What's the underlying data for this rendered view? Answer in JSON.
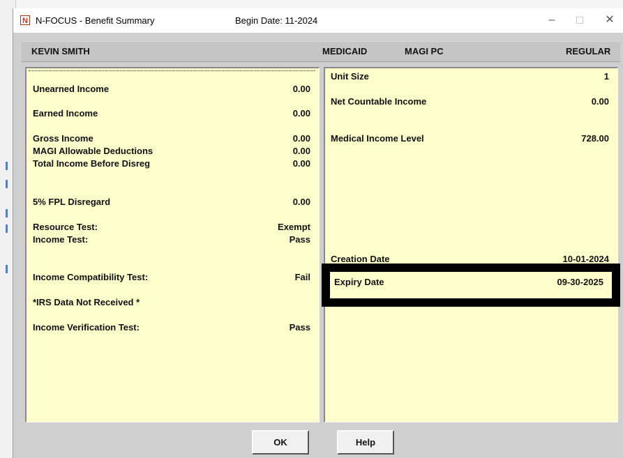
{
  "window": {
    "title": "N-FOCUS - Benefit Summary",
    "begin_date": "Begin Date: 11-2024",
    "icon_letter": "N",
    "minimize": "–",
    "maximize": "☐",
    "close": "✕"
  },
  "header": {
    "name": "KEVIN SMITH",
    "program": "MEDICAID",
    "subprogram": "MAGI PC",
    "type": "REGULAR"
  },
  "left_panel": {
    "unearned_income": {
      "label": "Unearned Income",
      "value": "0.00"
    },
    "earned_income": {
      "label": "Earned Income",
      "value": "0.00"
    },
    "gross_income": {
      "label": "Gross Income",
      "value": "0.00"
    },
    "magi_deductions": {
      "label": "MAGI Allowable Deductions",
      "value": "0.00"
    },
    "total_income": {
      "label": "Total Income Before Disreg",
      "value": "0.00"
    },
    "fpl_disregard": {
      "label": "5% FPL Disregard",
      "value": "0.00"
    },
    "resource_test": {
      "label": "Resource Test:",
      "value": "Exempt"
    },
    "income_test": {
      "label": "Income Test:",
      "value": "Pass"
    },
    "income_compat": {
      "label": "Income Compatibility Test:",
      "value": "Fail"
    },
    "irs_note": {
      "label": "*IRS Data Not Received  *"
    },
    "income_verif": {
      "label": "Income Verification Test:",
      "value": "Pass"
    }
  },
  "right_panel": {
    "unit_size": {
      "label": "Unit Size",
      "value": "1"
    },
    "net_countable": {
      "label": "Net Countable Income",
      "value": "0.00"
    },
    "medical_income_level": {
      "label": "Medical Income Level",
      "value": "728.00"
    },
    "creation_date": {
      "label": "Creation Date",
      "value": "10-01-2024"
    },
    "expiry_date": {
      "label": "Expiry Date",
      "value": "09-30-2025"
    }
  },
  "buttons": {
    "ok": "OK",
    "help": "Help"
  },
  "colors": {
    "panel_bg": "#ffffcc",
    "window_bg": "#cfcfcf",
    "highlight": "#000000"
  }
}
